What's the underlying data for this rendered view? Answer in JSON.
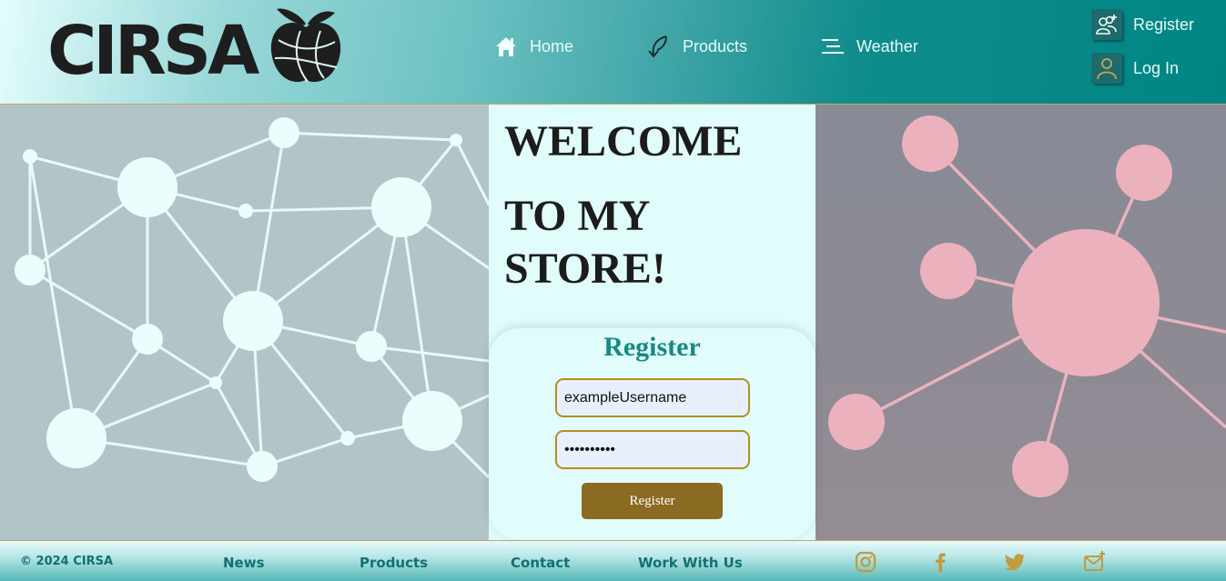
{
  "header": {
    "logo_text": "CIRSA",
    "nav": [
      {
        "label": "Home",
        "icon": "home-icon"
      },
      {
        "label": "Products",
        "icon": "leaf-arrow-icon"
      },
      {
        "label": "Weather",
        "icon": "menu-lines-icon"
      }
    ],
    "user_menu": [
      {
        "label": "Register",
        "icon": "add-users-icon"
      },
      {
        "label": "Log In",
        "icon": "user-icon"
      }
    ]
  },
  "main": {
    "welcome_line1": "WELCOME",
    "welcome_line2": "TO MY STORE!",
    "register_form": {
      "title": "Register",
      "username_value": "exampleUsername",
      "password_value": "••••••••••",
      "button_label": "Register"
    }
  },
  "footer": {
    "copyright": "© 2024 CIRSA",
    "links": [
      "News",
      "Products",
      "Contact",
      "Work With Us"
    ],
    "social_icons": [
      "instagram-icon",
      "facebook-icon",
      "twitter-icon",
      "mail-plus-icon"
    ]
  },
  "colors": {
    "header_teal": "#008585",
    "accent_gold": "#b4901f",
    "button_brown": "#8b6a22",
    "register_title": "#168a85",
    "pink_nodes": "#ebb2bd"
  }
}
